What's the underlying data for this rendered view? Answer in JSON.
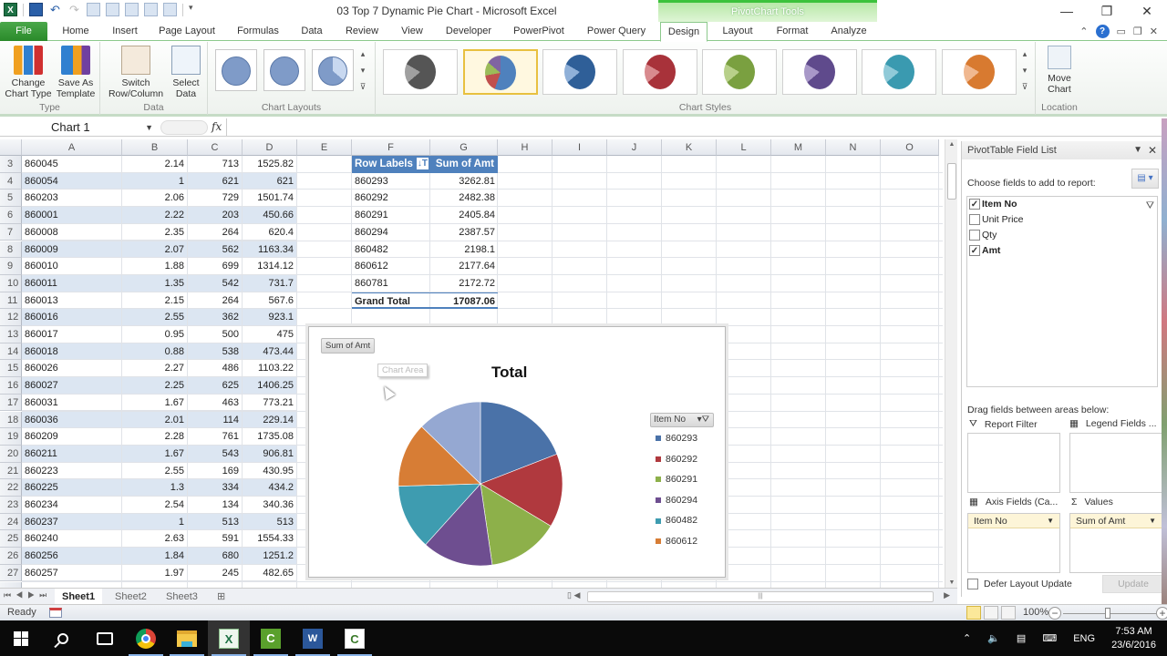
{
  "window": {
    "title": "03 Top 7 Dynamic Pie Chart  -  Microsoft Excel",
    "contextual_tab_group": "PivotChart Tools",
    "controls": {
      "minimize": "—",
      "restore": "❐",
      "close": "✕"
    }
  },
  "tabs": [
    {
      "label": "File"
    },
    {
      "label": "Home"
    },
    {
      "label": "Insert"
    },
    {
      "label": "Page Layout"
    },
    {
      "label": "Formulas"
    },
    {
      "label": "Data"
    },
    {
      "label": "Review"
    },
    {
      "label": "View"
    },
    {
      "label": "Developer"
    },
    {
      "label": "PowerPivot"
    },
    {
      "label": "Power Query"
    },
    {
      "label": "Design"
    },
    {
      "label": "Layout"
    },
    {
      "label": "Format"
    },
    {
      "label": "Analyze"
    }
  ],
  "active_tab": "Design",
  "ribbon": {
    "type_group": {
      "label": "Type",
      "change_chart_type": "Change\nChart Type",
      "change_l1": "Change",
      "change_l2": "Chart Type",
      "save_l1": "Save As",
      "save_l2": "Template"
    },
    "data_group": {
      "label": "Data",
      "switch_l1": "Switch",
      "switch_l2": "Row/Column",
      "select_l1": "Select",
      "select_l2": "Data"
    },
    "layouts_group": {
      "label": "Chart Layouts",
      "count_visible": 3
    },
    "styles_group": {
      "label": "Chart Styles",
      "styles": [
        {
          "name": "gray",
          "color": "#555555",
          "light": "#a0a0a0"
        },
        {
          "name": "colorful",
          "color": "#4f81bd",
          "light": "#c0504d",
          "selected": true
        },
        {
          "name": "blue",
          "color": "#2f5f98",
          "light": "#8fb0d8"
        },
        {
          "name": "red",
          "color": "#a8323a",
          "light": "#d88a8e"
        },
        {
          "name": "green",
          "color": "#7aa040",
          "light": "#b8d08a"
        },
        {
          "name": "purple",
          "color": "#5f4a8c",
          "light": "#a898c8"
        },
        {
          "name": "teal",
          "color": "#3a9ab0",
          "light": "#90cad8"
        },
        {
          "name": "orange",
          "color": "#d87a30",
          "light": "#f0b890"
        }
      ]
    },
    "location_group": {
      "label": "Location",
      "move_l1": "Move",
      "move_l2": "Chart"
    }
  },
  "formula_bar": {
    "name_box": "Chart 1",
    "fx": "fx",
    "formula": ""
  },
  "columns": [
    "A",
    "B",
    "C",
    "D",
    "E",
    "F",
    "G",
    "H",
    "I",
    "J",
    "K",
    "L",
    "M",
    "N",
    "O"
  ],
  "rows": [
    {
      "n": "3",
      "a": "860045",
      "b": "2.14",
      "c": "713",
      "d": "1525.82"
    },
    {
      "n": "4",
      "a": "860054",
      "b": "1",
      "c": "621",
      "d": "621"
    },
    {
      "n": "5",
      "a": "860203",
      "b": "2.06",
      "c": "729",
      "d": "1501.74"
    },
    {
      "n": "6",
      "a": "860001",
      "b": "2.22",
      "c": "203",
      "d": "450.66"
    },
    {
      "n": "7",
      "a": "860008",
      "b": "2.35",
      "c": "264",
      "d": "620.4"
    },
    {
      "n": "8",
      "a": "860009",
      "b": "2.07",
      "c": "562",
      "d": "1163.34"
    },
    {
      "n": "9",
      "a": "860010",
      "b": "1.88",
      "c": "699",
      "d": "1314.12"
    },
    {
      "n": "10",
      "a": "860011",
      "b": "1.35",
      "c": "542",
      "d": "731.7"
    },
    {
      "n": "11",
      "a": "860013",
      "b": "2.15",
      "c": "264",
      "d": "567.6"
    },
    {
      "n": "12",
      "a": "860016",
      "b": "2.55",
      "c": "362",
      "d": "923.1"
    },
    {
      "n": "13",
      "a": "860017",
      "b": "0.95",
      "c": "500",
      "d": "475"
    },
    {
      "n": "14",
      "a": "860018",
      "b": "0.88",
      "c": "538",
      "d": "473.44"
    },
    {
      "n": "15",
      "a": "860026",
      "b": "2.27",
      "c": "486",
      "d": "1103.22"
    },
    {
      "n": "16",
      "a": "860027",
      "b": "2.25",
      "c": "625",
      "d": "1406.25"
    },
    {
      "n": "17",
      "a": "860031",
      "b": "1.67",
      "c": "463",
      "d": "773.21"
    },
    {
      "n": "18",
      "a": "860036",
      "b": "2.01",
      "c": "114",
      "d": "229.14"
    },
    {
      "n": "19",
      "a": "860209",
      "b": "2.28",
      "c": "761",
      "d": "1735.08"
    },
    {
      "n": "20",
      "a": "860211",
      "b": "1.67",
      "c": "543",
      "d": "906.81"
    },
    {
      "n": "21",
      "a": "860223",
      "b": "2.55",
      "c": "169",
      "d": "430.95"
    },
    {
      "n": "22",
      "a": "860225",
      "b": "1.3",
      "c": "334",
      "d": "434.2"
    },
    {
      "n": "23",
      "a": "860234",
      "b": "2.54",
      "c": "134",
      "d": "340.36"
    },
    {
      "n": "24",
      "a": "860237",
      "b": "1",
      "c": "513",
      "d": "513"
    },
    {
      "n": "25",
      "a": "860240",
      "b": "2.63",
      "c": "591",
      "d": "1554.33"
    },
    {
      "n": "26",
      "a": "860256",
      "b": "1.84",
      "c": "680",
      "d": "1251.2"
    },
    {
      "n": "27",
      "a": "860257",
      "b": "1.97",
      "c": "245",
      "d": "482.65"
    }
  ],
  "pivot_table": {
    "header_row_labels": "Row Labels",
    "header_values": "Sum of Amt",
    "rows": [
      {
        "label": "860293",
        "value": "3262.81"
      },
      {
        "label": "860292",
        "value": "2482.38"
      },
      {
        "label": "860291",
        "value": "2405.84"
      },
      {
        "label": "860294",
        "value": "2387.57"
      },
      {
        "label": "860482",
        "value": "2198.1"
      },
      {
        "label": "860612",
        "value": "2177.64"
      },
      {
        "label": "860781",
        "value": "2172.72"
      }
    ],
    "grand_total_label": "Grand Total",
    "grand_total_value": "17087.06"
  },
  "chart": {
    "value_field_button": "Sum of Amt",
    "tooltip": "Chart Area",
    "title": "Total",
    "legend_field_button": "Item No",
    "legend": [
      {
        "label": "860293",
        "color": "#4a72a8"
      },
      {
        "label": "860292",
        "color": "#b0393e"
      },
      {
        "label": "860291",
        "color": "#8db04a"
      },
      {
        "label": "860294",
        "color": "#6e4e90"
      },
      {
        "label": "860482",
        "color": "#3e9cb0"
      },
      {
        "label": "860612",
        "color": "#d77d35"
      }
    ]
  },
  "chart_data": {
    "type": "pie",
    "title": "Total",
    "categories": [
      "860293",
      "860292",
      "860291",
      "860294",
      "860482",
      "860612",
      "860781"
    ],
    "values": [
      3262.81,
      2482.38,
      2405.84,
      2387.57,
      2198.1,
      2177.64,
      2172.72
    ],
    "colors": [
      "#4a72a8",
      "#b0393e",
      "#8db04a",
      "#6e4e90",
      "#3e9cb0",
      "#d77d35",
      "#95a8d2"
    ],
    "legend_title": "Item No",
    "legend_entries_visible": [
      "860293",
      "860292",
      "860291",
      "860294",
      "860482",
      "860612"
    ],
    "legend_position": "right",
    "value_field": "Sum of Amt"
  },
  "field_list": {
    "title": "PivotTable Field List",
    "choose_label": "Choose fields to add to report:",
    "fields": [
      {
        "label": "Item No",
        "checked": true,
        "bold": true
      },
      {
        "label": "Unit Price",
        "checked": false,
        "bold": false
      },
      {
        "label": "Qty",
        "checked": false,
        "bold": false
      },
      {
        "label": "Amt",
        "checked": true,
        "bold": true
      }
    ],
    "drag_label": "Drag fields between areas below:",
    "report_filter_label": "Report Filter",
    "legend_fields_label": "Legend Fields ...",
    "axis_fields_label": "Axis Fields (Ca...",
    "values_label": "Values",
    "axis_chip": "Item No",
    "values_chip": "Sum of Amt",
    "defer_label": "Defer Layout Update",
    "update_label": "Update"
  },
  "sheets": [
    {
      "label": "Sheet1",
      "active": true
    },
    {
      "label": "Sheet2",
      "active": false
    },
    {
      "label": "Sheet3",
      "active": false
    }
  ],
  "status": {
    "ready": "Ready",
    "zoom": "100%",
    "zoom_level_percent": 100
  },
  "taskbar": {
    "apps": [
      "start",
      "search",
      "task-view",
      "chrome",
      "file-explorer",
      "excel",
      "camtasia",
      "word",
      "camtasia-recorder"
    ],
    "language": "ENG",
    "time": "7:53 AM",
    "date": "23/6/2016"
  }
}
